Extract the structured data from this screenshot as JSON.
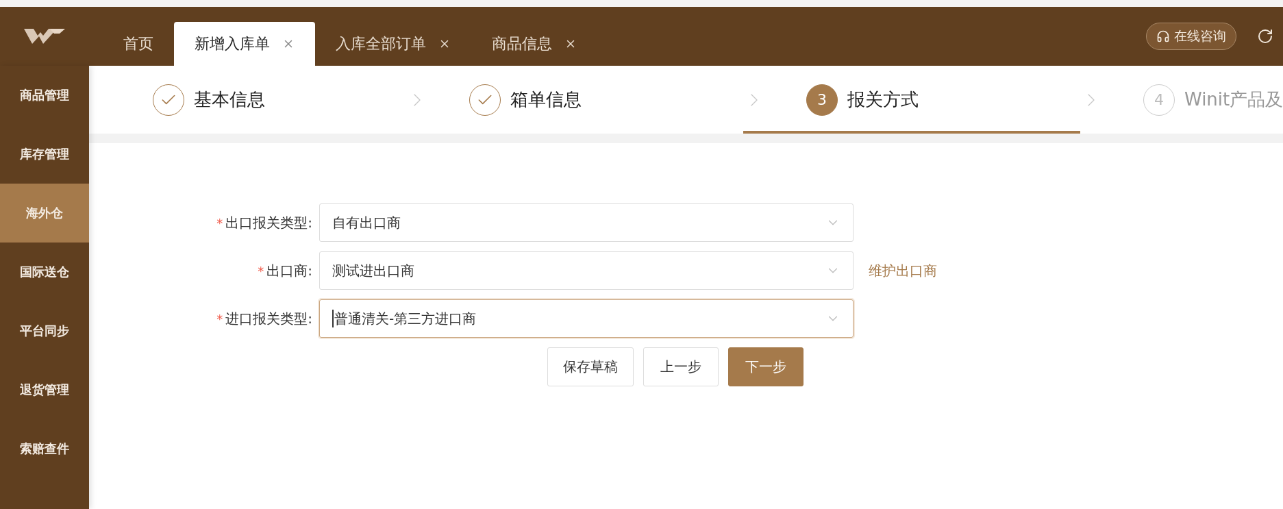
{
  "header": {
    "tabs": [
      {
        "label": "首页",
        "closable": false,
        "selected": false
      },
      {
        "label": "新增入库单",
        "closable": true,
        "selected": true
      },
      {
        "label": "入库全部订单",
        "closable": true,
        "selected": false
      },
      {
        "label": "商品信息",
        "closable": true,
        "selected": false
      }
    ],
    "consult_button": "在线咨询"
  },
  "sidebar": {
    "items": [
      {
        "label": "商品管理",
        "selected": false
      },
      {
        "label": "库存管理",
        "selected": false
      },
      {
        "label": "海外仓",
        "selected": true
      },
      {
        "label": "国际送仓",
        "selected": false
      },
      {
        "label": "平台同步",
        "selected": false
      },
      {
        "label": "退货管理",
        "selected": false
      },
      {
        "label": "索赔查件",
        "selected": false
      }
    ]
  },
  "steps": [
    {
      "kind": "done",
      "label": "基本信息"
    },
    {
      "kind": "done",
      "label": "箱单信息"
    },
    {
      "kind": "active",
      "number": "3",
      "label": "报关方式"
    },
    {
      "kind": "pending",
      "number": "4",
      "label": "Winit产品及"
    }
  ],
  "form": {
    "fields": [
      {
        "required_mark": "*",
        "label": "出口报关类型:",
        "value": "自有出口商",
        "focused": false
      },
      {
        "required_mark": "*",
        "label": "出口商:",
        "value": "测试进出口商",
        "focused": false,
        "link": "维护出口商"
      },
      {
        "required_mark": "*",
        "label": "进口报关类型:",
        "value": "普通清关-第三方进口商",
        "focused": true
      }
    ],
    "buttons": [
      {
        "label": "保存草稿",
        "kind": "default"
      },
      {
        "label": "上一步",
        "kind": "default"
      },
      {
        "label": "下一步",
        "kind": "primary"
      }
    ]
  }
}
